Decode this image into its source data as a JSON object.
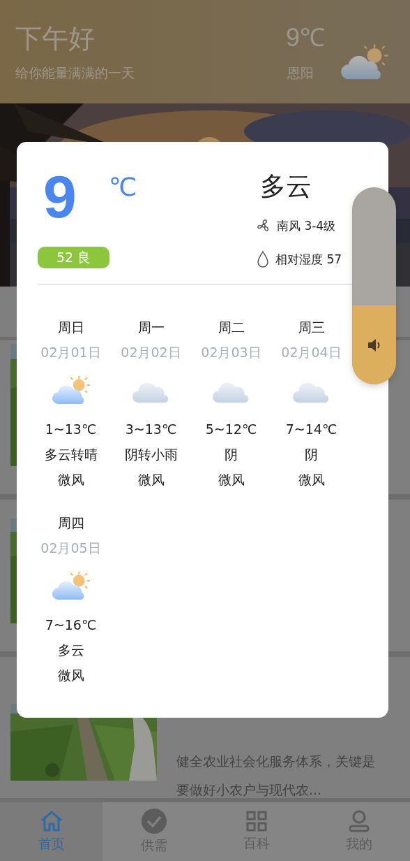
{
  "header": {
    "greeting": "下午好",
    "subtitle": "给你能量满满的一天",
    "temperature": "9℃",
    "location": "恩阳",
    "kind": "partly_cloudy"
  },
  "banner": {
    "kind": "picture"
  },
  "articles": [
    {
      "kind": "picture"
    },
    {
      "kind": "picture"
    },
    {
      "kind": "picture",
      "excerpt": "健全农业社会化服务体系，关键是要做好小农户与现代农..."
    }
  ],
  "nav": [
    {
      "label": "首页",
      "kind": "home",
      "selected": true
    },
    {
      "label": "供需",
      "kind": "check",
      "selected": false
    },
    {
      "label": "百科",
      "kind": "grid",
      "selected": false
    },
    {
      "label": "我的",
      "kind": "user",
      "selected": false
    }
  ],
  "weather": {
    "temperature": "9",
    "unit": "℃",
    "condition": "多云",
    "wind": "南风 3-4级",
    "humidity": "相对湿度 57",
    "aqi": "52 良",
    "forecast": [
      {
        "weekday": "周日",
        "date": "02月01日",
        "kind": "partly_cloudy",
        "temp": "1~13℃",
        "condition": "多云转晴",
        "wind": "微风"
      },
      {
        "weekday": "周一",
        "date": "02月02日",
        "kind": "cloudy",
        "temp": "3~13℃",
        "condition": "阴转小雨",
        "wind": "微风"
      },
      {
        "weekday": "周二",
        "date": "02月03日",
        "kind": "cloudy",
        "temp": "5~12℃",
        "condition": "阴",
        "wind": "微风"
      },
      {
        "weekday": "周三",
        "date": "02月04日",
        "kind": "cloudy",
        "temp": "7~14℃",
        "condition": "阴",
        "wind": "微风"
      },
      {
        "weekday": "周四",
        "date": "02月05日",
        "kind": "partly_cloudy",
        "temp": "7~16℃",
        "condition": "多云",
        "wind": "微风"
      }
    ]
  },
  "volume": {
    "level": 0.4
  }
}
